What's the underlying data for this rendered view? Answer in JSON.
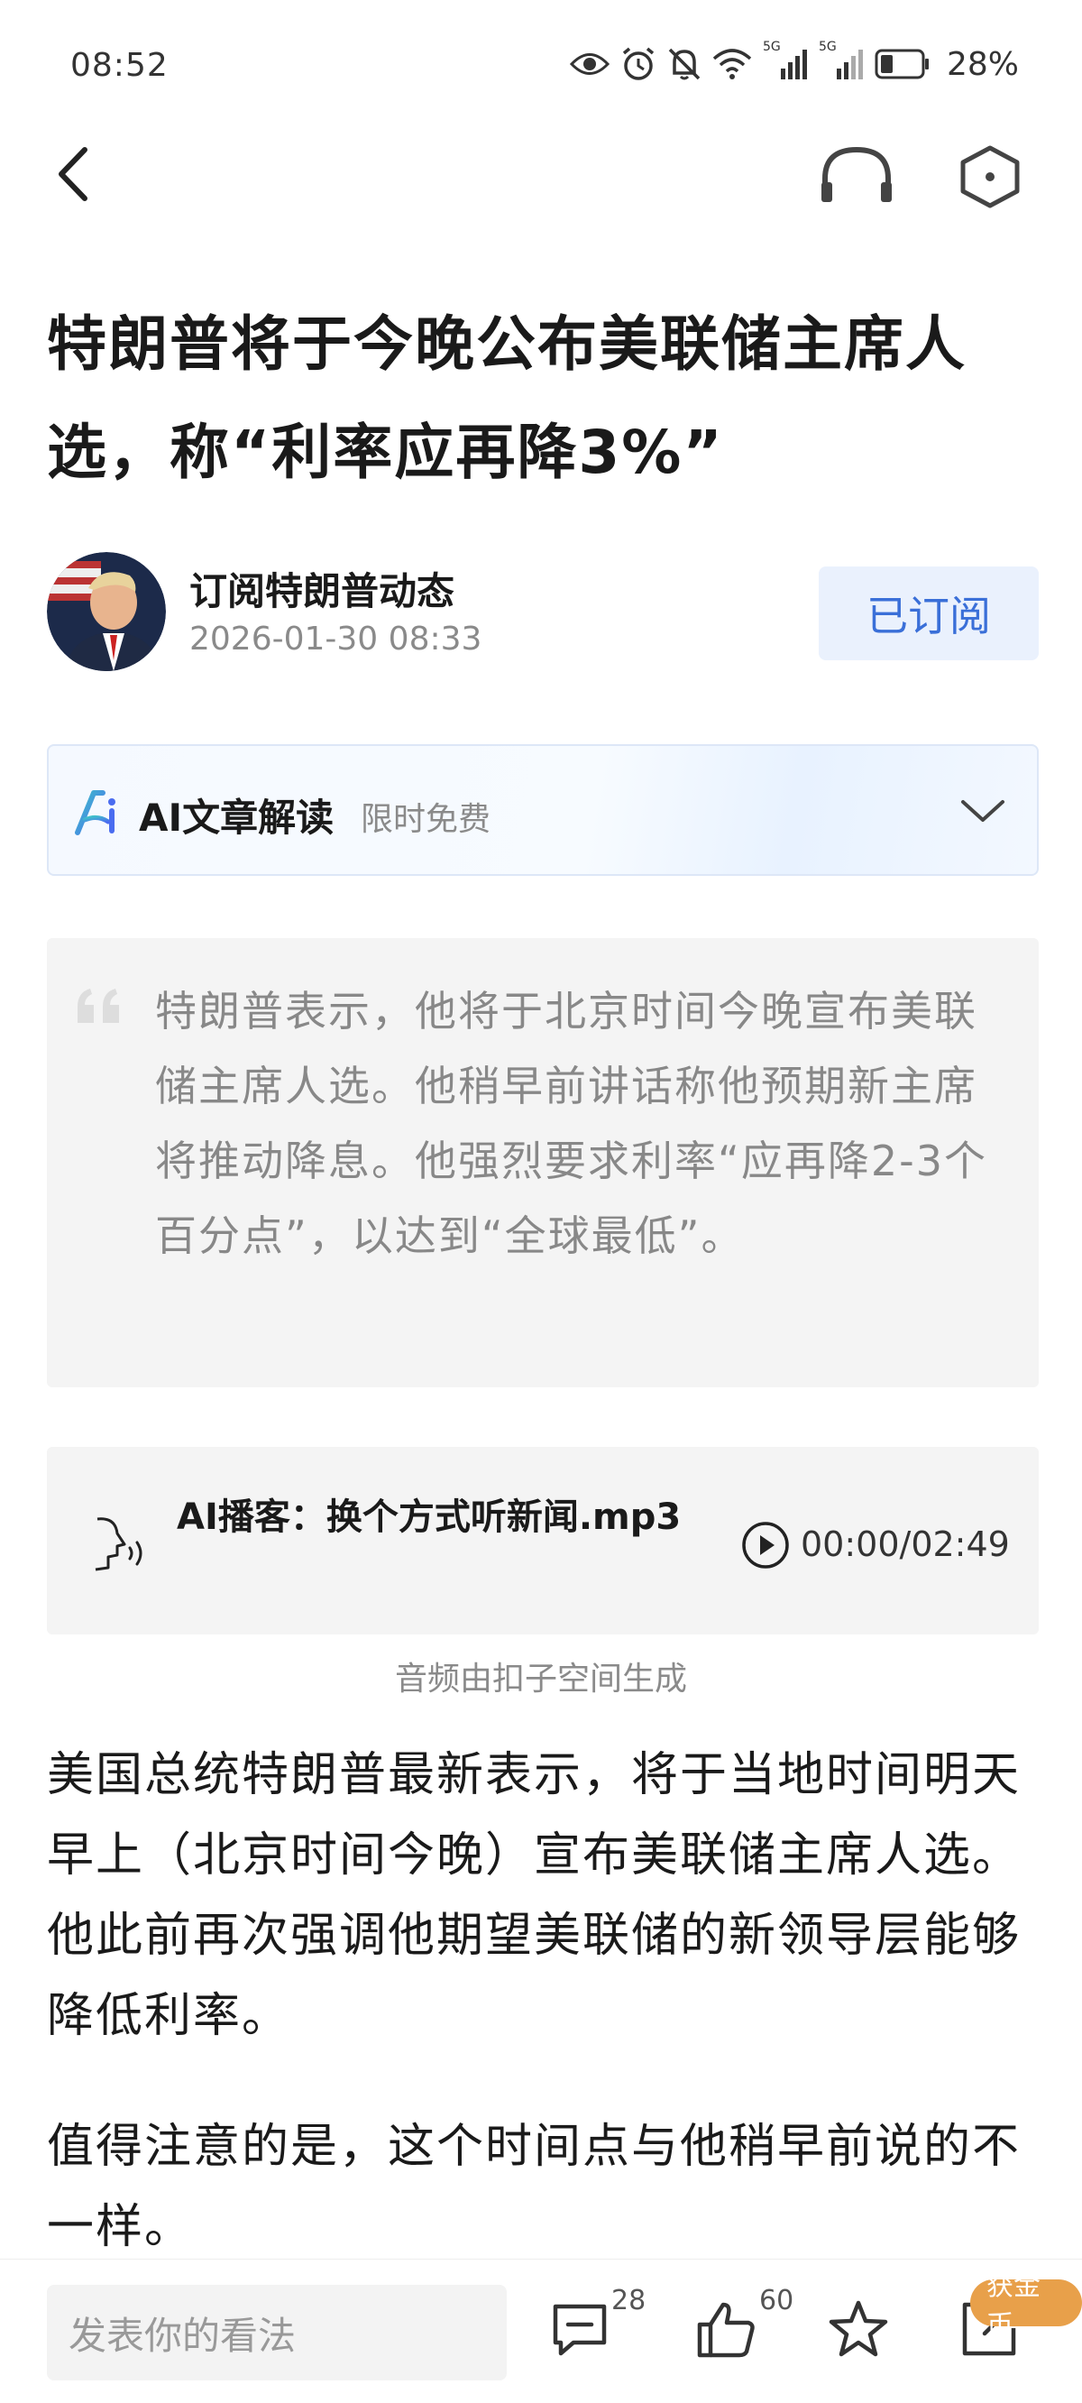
{
  "status_bar": {
    "time": "08:52",
    "network_1": "5G",
    "network_2": "5G",
    "battery_percent": "28%"
  },
  "nav": {
    "back_icon": "chevron-left-icon",
    "listen_icon": "headset-icon",
    "more_icon": "hexagon-icon"
  },
  "article": {
    "title": "特朗普将于今晚公布美联储主席人选，称“利率应再降3%”"
  },
  "author": {
    "name": "订阅特朗普动态",
    "datetime": "2026-01-30 08:33",
    "subscribe_label": "已订阅"
  },
  "ai_interpret": {
    "label": "AI文章解读",
    "sub_label": "限时免费"
  },
  "summary_quote": "特朗普表示，他将于北京时间今晚宣布美联储主席人选。他稍早前讲话称他预期新主席将推动降息。他强烈要求利率“应再降2-3个百分点”，以达到“全球最低”。",
  "podcast": {
    "title": "AI播客：换个方式听新闻.mp3",
    "time": "00:00/02:49",
    "caption": "音频由扣子空间生成"
  },
  "body": {
    "paragraphs": [
      "美国总统特朗普最新表示，将于当地时间明天早上（北京时间今晚）宣布美联储主席人选。他此前再次强调他期望美联储的新领导层能够降低利率。",
      "值得注意的是，这个时间点与他稍早前说的不一样。"
    ]
  },
  "bottom_bar": {
    "comment_placeholder": "发表你的看法",
    "comment_count": "28",
    "like_count": "60",
    "coin_badge": "获金币"
  },
  "colors": {
    "accent_blue": "#3a6fd8",
    "subscribe_bg": "#eaf1fd",
    "coin_orange": "#e8a04a",
    "quote_bg": "#f4f4f4"
  }
}
